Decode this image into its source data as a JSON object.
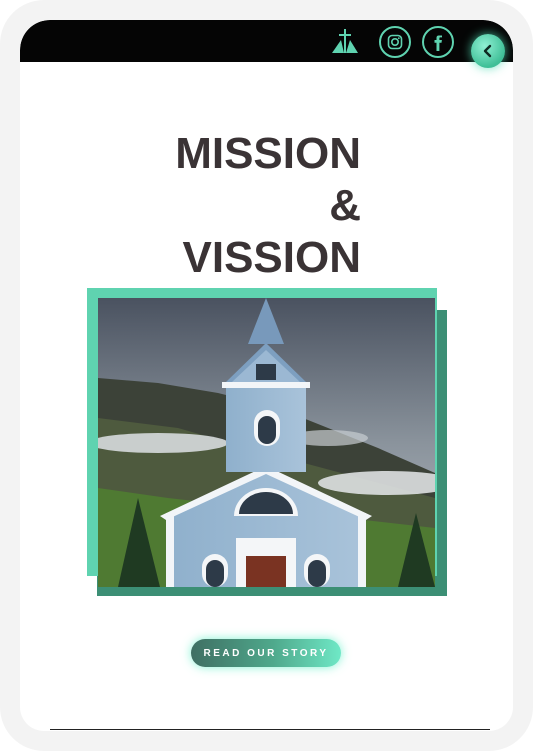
{
  "header": {
    "logo_icon": "church-logo-icon",
    "social": [
      {
        "name": "instagram",
        "icon": "instagram-icon"
      },
      {
        "name": "facebook",
        "icon": "facebook-icon"
      }
    ],
    "back_icon": "chevron-left-icon"
  },
  "main": {
    "title_lines": [
      "MISSION",
      "&",
      "VISSION"
    ],
    "image_alt": "church-photo",
    "cta_label": "READ OUR STORY"
  },
  "colors": {
    "accent": "#5fd3b0",
    "accent_dark": "#3c8f75",
    "title": "#3a3335",
    "topbar": "#050505"
  }
}
